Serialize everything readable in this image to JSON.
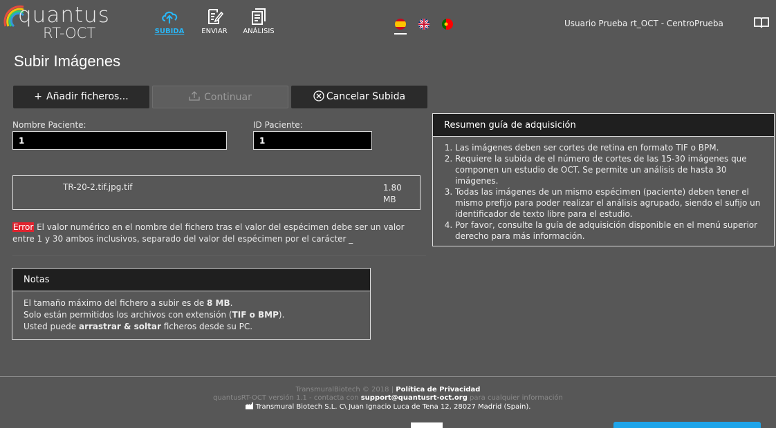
{
  "logo": {
    "line1": "quantus",
    "line2": "RT-OCT"
  },
  "nav": [
    {
      "label": "SUBIDA"
    },
    {
      "label": "ENVIAR"
    },
    {
      "label": "ANÁLISIS"
    }
  ],
  "user": {
    "label": "Usuario Prueba rt_OCT - CentroPrueba"
  },
  "page": {
    "title": "Subir Imágenes"
  },
  "buttons": {
    "add": "Añadir ficheros...",
    "continue": "Continuar",
    "cancel": "Cancelar Subida"
  },
  "form": {
    "patient_name_label": "Nombre Paciente:",
    "patient_name_value": "1",
    "patient_id_label": "ID Paciente:",
    "patient_id_value": "1"
  },
  "file": {
    "name": "TR-20-2.tif.jpg.tif",
    "size_value": "1.80",
    "size_unit": "MB"
  },
  "error": {
    "tag": "Error",
    "message": " El valor numérico en el nombre del fichero tras el valor del espécimen debe ser un valor entre 1 y 30 ambos inclusivos, separado del valor del espécimen por el carácter _"
  },
  "notes": {
    "title": "Notas",
    "line1_pre": "El tamaño máximo del fichero a subir es de ",
    "line1_bold": "8 MB",
    "line1_post": ".",
    "line2_pre": "Solo están permitidos los archivos con extensión (",
    "line2_bold": "TIF o BMP",
    "line2_post": ").",
    "line3_pre": "Usted puede ",
    "line3_bold": "arrastrar & soltar",
    "line3_post": " ficheros desde su PC."
  },
  "summary": {
    "title": "Resumen guía de adquisición",
    "items": [
      "Las imágenes deben ser cortes de retina en formato TIF o BPM.",
      "Requiere la subida de el número de cortes de las 15-30 imágenes que componen un estudio de OCT. Se permite un análisis de hasta 30 imágenes.",
      "Todas las imágenes de un mismo espécimen (paciente) deben tener el mismo prefijo para poder realizar el análisis agrupado, siendo el sufijo un identificador de texto libre para el estudio.",
      "Por favor, consulte la guía de adquisición disponible en el menú superior derecho para más información."
    ]
  },
  "footer": {
    "line1_pre": "TransmuralBiotech © 2018 | ",
    "line1_link": "Política de Privacidad",
    "line2_pre": "quantusRT-OCT versión 1.1 - contacta con ",
    "line2_link": "support@quantusrt-oct.org",
    "line2_post": " para cualquier información",
    "line3": "Transmural Biotech S.L. C\\ Juan Ignacio Luca de Tena 12, 28027 Madrid (Spain)."
  },
  "colors": {
    "background": "#575757",
    "accent": "#29b6f6",
    "error": "#e0242f",
    "panel_header": "#1f1f1f"
  }
}
